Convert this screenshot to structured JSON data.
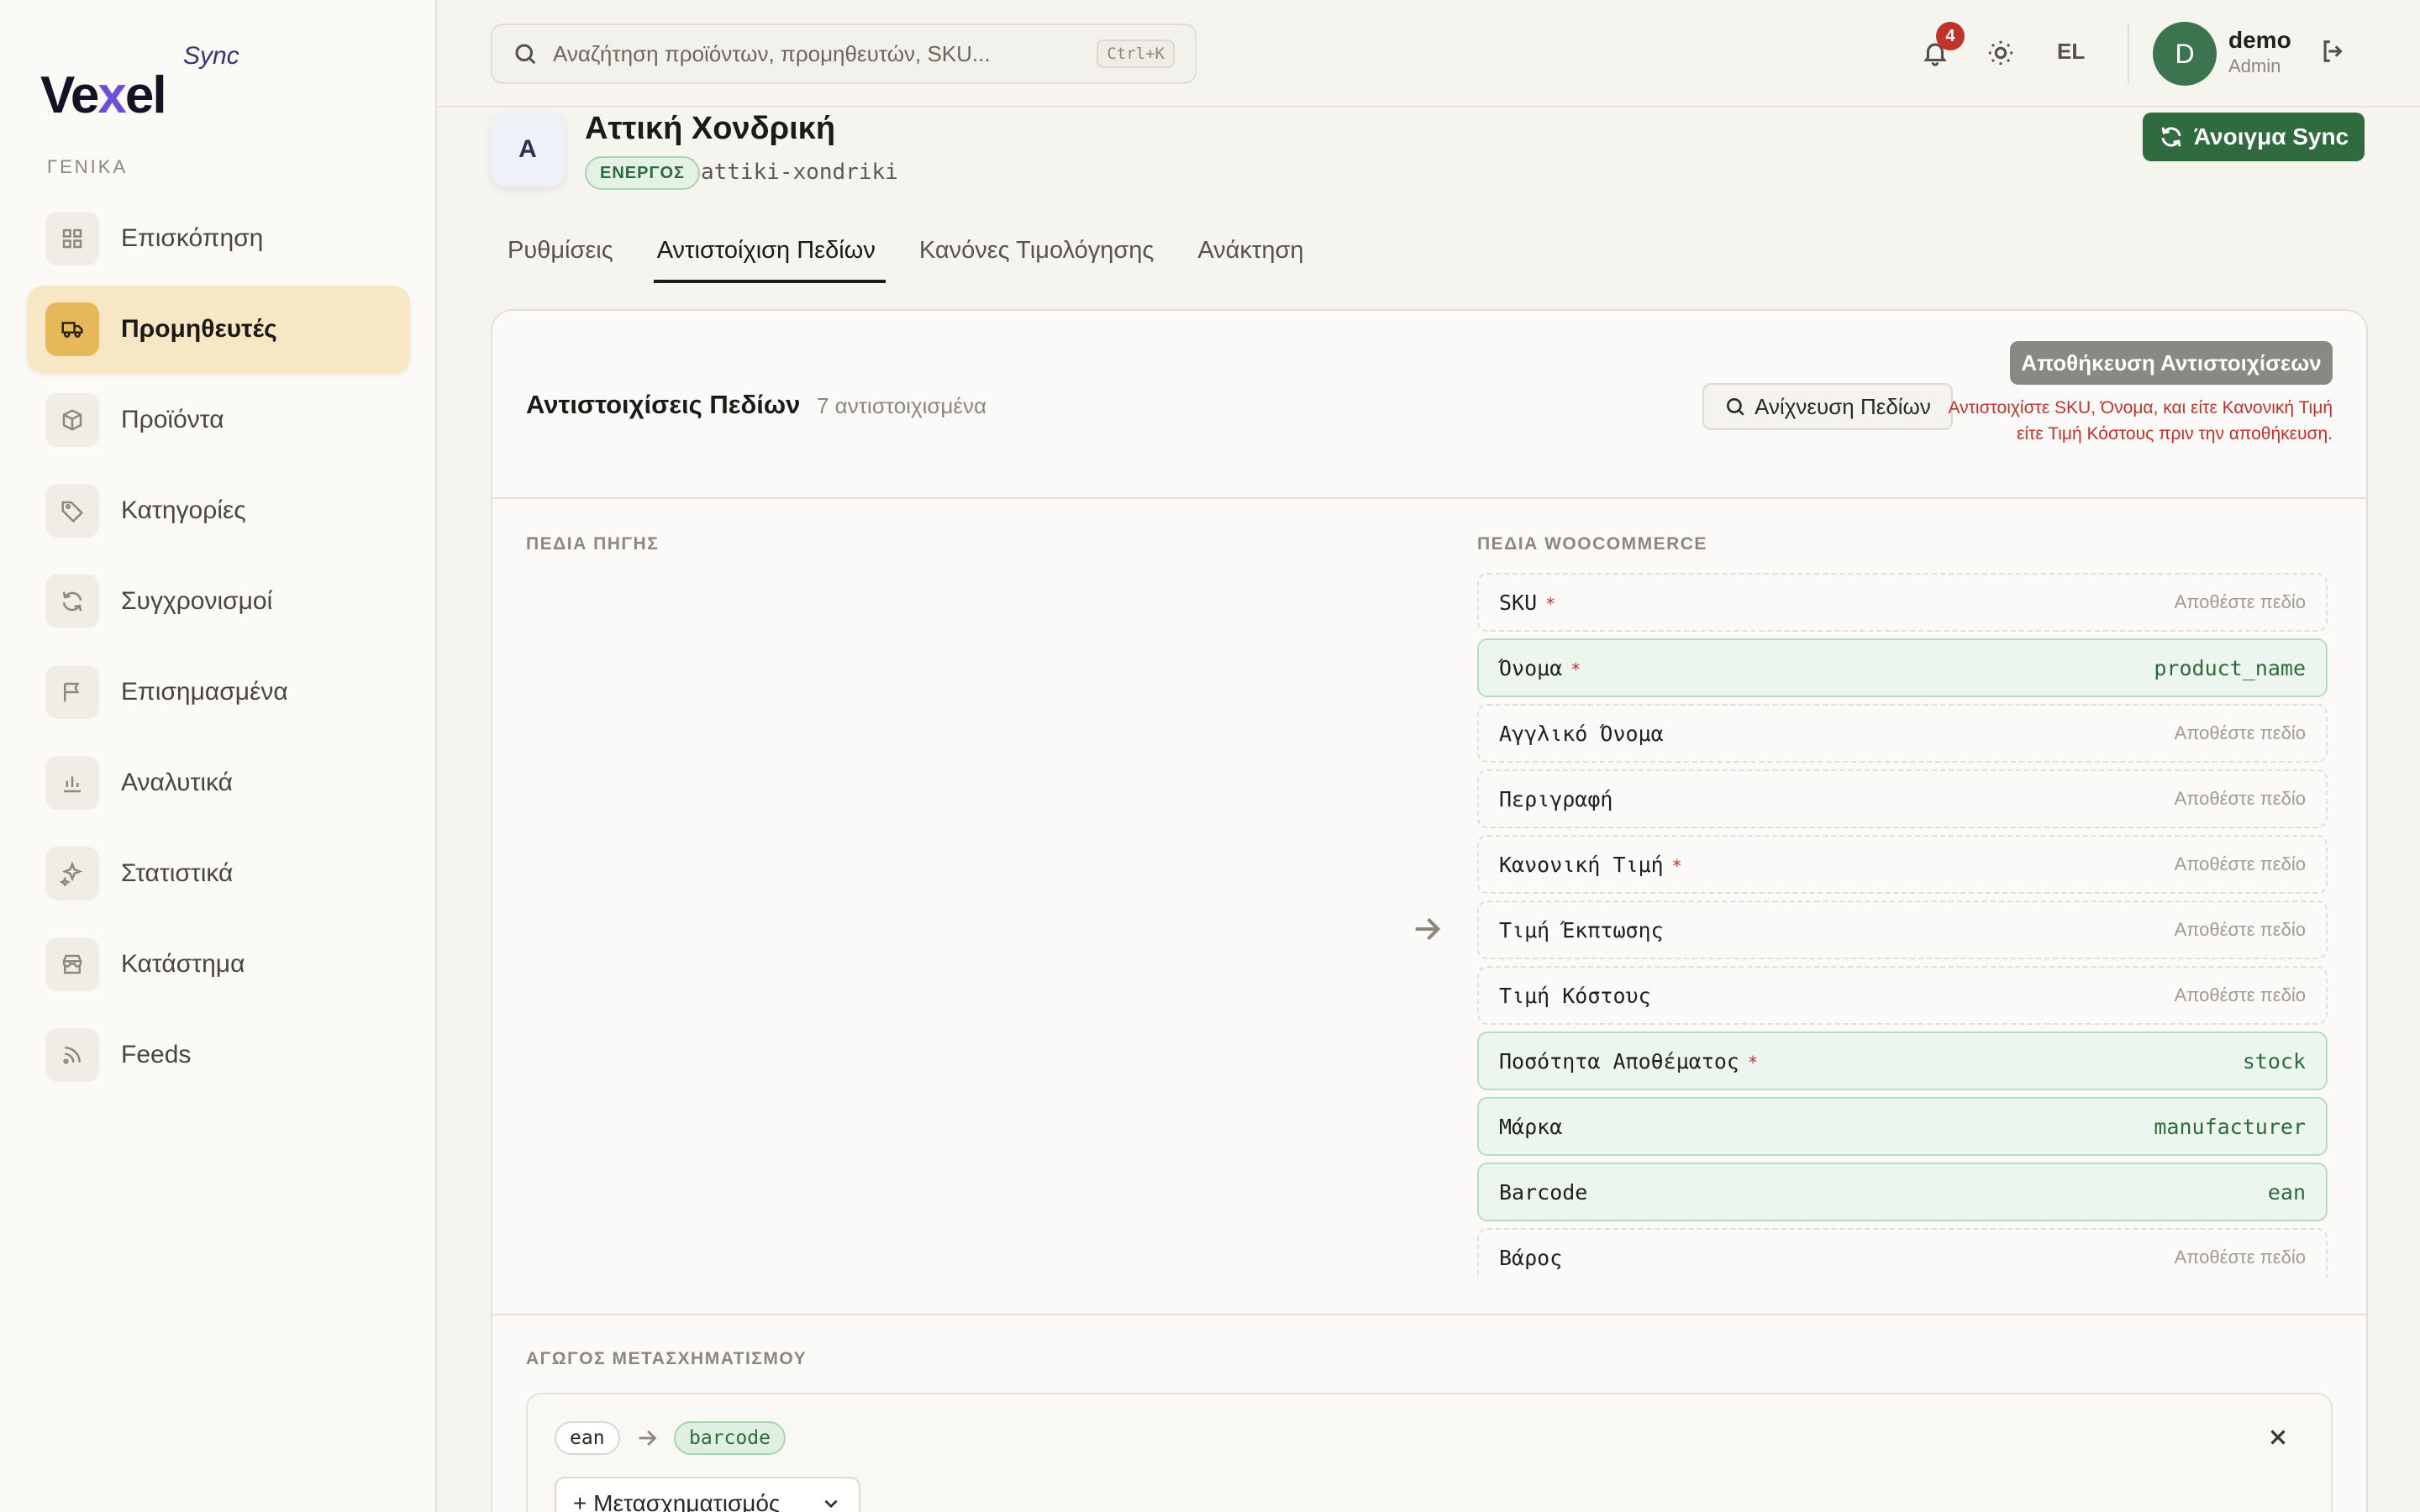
{
  "brand": {
    "name_pre": "Ve",
    "name_x": "x",
    "name_post": "el",
    "suffix": "Sync"
  },
  "sidebar": {
    "section_label": "ΓΕΝΙΚΑ",
    "items": [
      {
        "label": "Επισκόπηση",
        "icon": "grid-icon",
        "active": false
      },
      {
        "label": "Προμηθευτές",
        "icon": "truck-icon",
        "active": true
      },
      {
        "label": "Προϊόντα",
        "icon": "box-icon",
        "active": false
      },
      {
        "label": "Κατηγορίες",
        "icon": "tag-icon",
        "active": false
      },
      {
        "label": "Συγχρονισμοί",
        "icon": "refresh-icon",
        "active": false
      },
      {
        "label": "Επισημασμένα",
        "icon": "flag-icon",
        "active": false
      },
      {
        "label": "Αναλυτικά",
        "icon": "bar-chart-icon",
        "active": false
      },
      {
        "label": "Στατιστικά",
        "icon": "sparkles-icon",
        "active": false
      },
      {
        "label": "Κατάστημα",
        "icon": "store-icon",
        "active": false
      },
      {
        "label": "Feeds",
        "icon": "rss-icon",
        "active": false
      }
    ]
  },
  "topbar": {
    "search_placeholder": "Αναζήτηση προϊόντων, προμηθευτών, SKU...",
    "search_shortcut": "Ctrl+K",
    "notification_count": "4",
    "language": "EL",
    "user_initial": "D",
    "user_name": "demo",
    "user_role": "Admin"
  },
  "supplier": {
    "initial": "A",
    "name": "Αττική Χονδρική",
    "status": "ΕΝΕΡΓΟΣ",
    "slug": "attiki-xondriki",
    "open_sync_label": "Άνοιγμα Sync"
  },
  "tabs": [
    {
      "label": "Ρυθμίσεις",
      "active": false
    },
    {
      "label": "Αντιστοίχιση Πεδίων",
      "active": true
    },
    {
      "label": "Κανόνες Τιμολόγησης",
      "active": false
    },
    {
      "label": "Ανάκτηση",
      "active": false
    }
  ],
  "mapping": {
    "title": "Αντιστοιχίσεις Πεδίων",
    "count_label": "7 αντιστοιχισμένα",
    "detect_label": "Ανίχνευση Πεδίων",
    "save_label": "Αποθήκευση Αντιστοιχίσεων",
    "warning": "Αντιστοιχίστε SKU, Όνομα, και είτε Κανονική Τιμή είτε Τιμή Κόστους πριν την αποθήκευση.",
    "source_label": "ΠΕΔΙΑ ΠΗΓΗΣ",
    "woo_label": "ΠΕΔΙΑ WOOCOMMERCE",
    "drop_placeholder": "Αποθέστε πεδίο",
    "woo_fields": [
      {
        "name": "SKU",
        "required": true,
        "mapped": ""
      },
      {
        "name": "Όνομα",
        "required": true,
        "mapped": "product_name"
      },
      {
        "name": "Αγγλικό Όνομα",
        "required": false,
        "mapped": ""
      },
      {
        "name": "Περιγραφή",
        "required": false,
        "mapped": ""
      },
      {
        "name": "Κανονική Τιμή",
        "required": true,
        "mapped": ""
      },
      {
        "name": "Τιμή Έκπτωσης",
        "required": false,
        "mapped": ""
      },
      {
        "name": "Τιμή Κόστους",
        "required": false,
        "mapped": ""
      },
      {
        "name": "Ποσότητα Αποθέματος",
        "required": true,
        "mapped": "stock"
      },
      {
        "name": "Μάρκα",
        "required": false,
        "mapped": "manufacturer"
      },
      {
        "name": "Barcode",
        "required": false,
        "mapped": "ean"
      },
      {
        "name": "Βάρος",
        "required": false,
        "mapped": ""
      }
    ],
    "required_marker": "*"
  },
  "transform": {
    "section_label": "ΑΓΩΓΟΣ ΜΕΤΑΣΧΗΜΑΤΙΣΜΟΥ",
    "source": "ean",
    "target": "barcode",
    "add_label": "+ Μετασχηματισμός"
  },
  "colors": {
    "accent_green": "#2f6b3e",
    "active_nav": "#f7e7c4",
    "warning_red": "#c0332b"
  }
}
